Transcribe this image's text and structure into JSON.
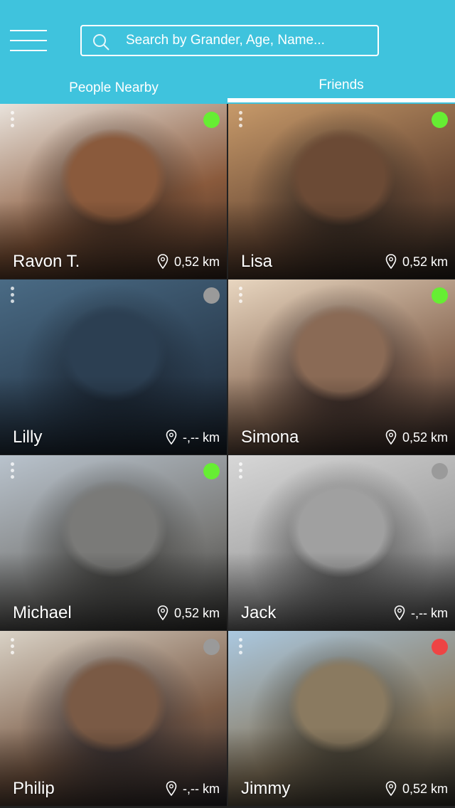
{
  "search": {
    "placeholder": "Search by Grander, Age, Name..."
  },
  "tabs": [
    {
      "label": "People Nearby",
      "active": false
    },
    {
      "label": "Friends",
      "active": true
    }
  ],
  "colors": {
    "header": "#3fc3dd",
    "online": "#66ee33",
    "offline": "#9a9a9a",
    "busy": "#ee4444"
  },
  "people": [
    {
      "name": "Ravon T.",
      "distance": "0,52 km",
      "status": "online",
      "tone": [
        "#e9e3dc",
        "#8a5a3c",
        "#3a2a22"
      ]
    },
    {
      "name": "Lisa",
      "distance": "0,52 km",
      "status": "online",
      "tone": [
        "#c79a6a",
        "#6b4a35",
        "#2c2520"
      ]
    },
    {
      "name": "Lilly",
      "distance": "-,-- km",
      "status": "offline",
      "tone": [
        "#4a6b85",
        "#2c3f52",
        "#1a2430"
      ]
    },
    {
      "name": "Simona",
      "distance": "0,52 km",
      "status": "online",
      "tone": [
        "#e8d6c0",
        "#8a6a55",
        "#2a2020"
      ]
    },
    {
      "name": "Michael",
      "distance": "0,52 km",
      "status": "online",
      "tone": [
        "#b9c3cd",
        "#7a7a78",
        "#3a3a38"
      ]
    },
    {
      "name": "Jack",
      "distance": "-,-- km",
      "status": "offline",
      "tone": [
        "#d7d7d7",
        "#a0a0a0",
        "#4a4a4a"
      ]
    },
    {
      "name": "Philip",
      "distance": "-,-- km",
      "status": "offline",
      "tone": [
        "#d9d2c6",
        "#7a5a45",
        "#2c2a30"
      ]
    },
    {
      "name": "Jimmy",
      "distance": "0,52 km",
      "status": "busy",
      "tone": [
        "#aac8e0",
        "#8a7a60",
        "#3a3830"
      ]
    }
  ]
}
